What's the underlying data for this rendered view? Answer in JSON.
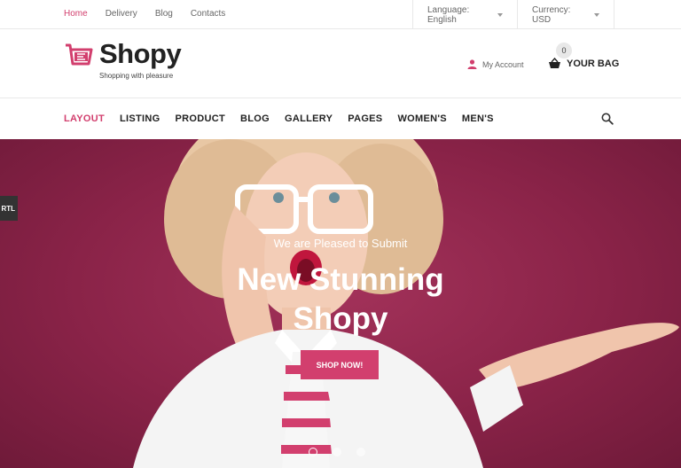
{
  "topbar": {
    "links": [
      {
        "label": "Home",
        "active": true
      },
      {
        "label": "Delivery",
        "active": false
      },
      {
        "label": "Blog",
        "active": false
      },
      {
        "label": "Contacts",
        "active": false
      }
    ],
    "language_label": "Language: English",
    "currency_label": "Currency: USD"
  },
  "header": {
    "logo_text": "Shopy",
    "tagline": "Shopping with pleasure",
    "account_label": "My Account",
    "bag_label": "YOUR BAG",
    "bag_count": "0"
  },
  "nav": {
    "items": [
      {
        "label": "LAYOUT",
        "active": true
      },
      {
        "label": "LISTING",
        "active": false
      },
      {
        "label": "PRODUCT",
        "active": false
      },
      {
        "label": "BLOG",
        "active": false
      },
      {
        "label": "GALLERY",
        "active": false
      },
      {
        "label": "PAGES",
        "active": false
      },
      {
        "label": "WOMEN'S",
        "active": false
      },
      {
        "label": "MEN'S",
        "active": false
      }
    ],
    "search_icon": "search-icon"
  },
  "hero": {
    "rtl_label": "RTL",
    "subtitle": "We are Pleased to Submit",
    "title_line1": "New Stunning",
    "title_line2": "Shopy",
    "button_label": "SHOP NOW!",
    "slide_count": 3,
    "active_slide": 1
  },
  "colors": {
    "accent": "#d23f6e",
    "hero_bg": "#8a2348",
    "text_dark": "#222222"
  }
}
